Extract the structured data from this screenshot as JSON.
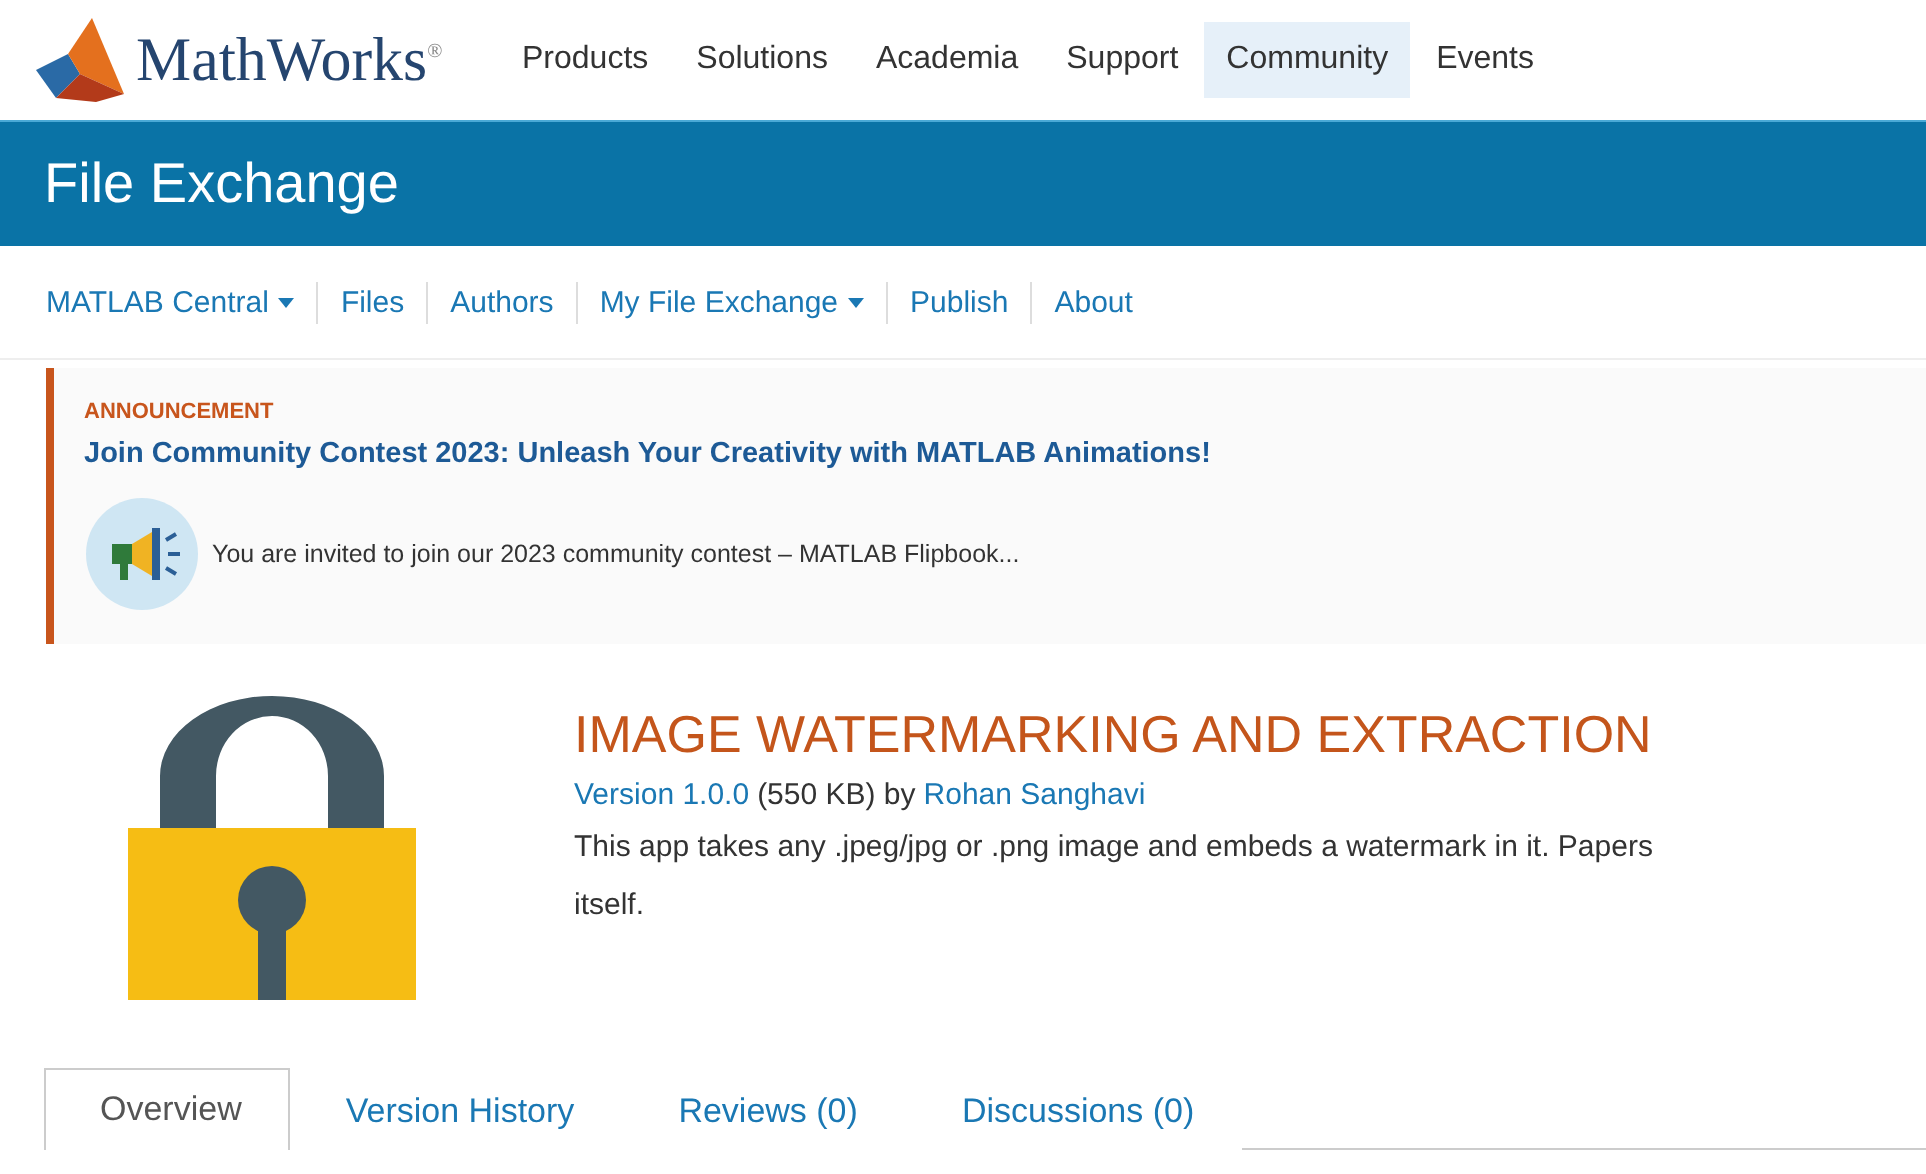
{
  "header": {
    "logo_text": "MathWorks",
    "logo_mark": "®",
    "nav": [
      {
        "label": "Products",
        "selected": false
      },
      {
        "label": "Solutions",
        "selected": false
      },
      {
        "label": "Academia",
        "selected": false
      },
      {
        "label": "Support",
        "selected": false
      },
      {
        "label": "Community",
        "selected": true
      },
      {
        "label": "Events",
        "selected": false
      }
    ]
  },
  "banner": {
    "title": "File Exchange"
  },
  "subnav": [
    {
      "label": "MATLAB Central",
      "dropdown": true
    },
    {
      "label": "Files",
      "dropdown": false
    },
    {
      "label": "Authors",
      "dropdown": false
    },
    {
      "label": "My File Exchange",
      "dropdown": true
    },
    {
      "label": "Publish",
      "dropdown": false
    },
    {
      "label": "About",
      "dropdown": false
    }
  ],
  "announcement": {
    "tag": "ANNOUNCEMENT",
    "title": "Join Community Contest 2023: Unleash Your Creativity with MATLAB Animations!",
    "message": "You are invited to join our 2023 community contest – MATLAB Flipbook..."
  },
  "file": {
    "title": "IMAGE WATERMARKING AND EXTRACTION",
    "version": "Version 1.0.0",
    "size": "(550 KB) by",
    "author": "Rohan Sanghavi",
    "description_lines": [
      "This app takes any .jpeg/jpg or .png image and embeds a watermark in it. Papers",
      "itself."
    ]
  },
  "tabs": [
    {
      "label": "Overview",
      "selected": true
    },
    {
      "label": "Version History",
      "selected": false
    },
    {
      "label": "Reviews (0)",
      "selected": false
    },
    {
      "label": "Discussions (0)",
      "selected": false
    }
  ]
}
